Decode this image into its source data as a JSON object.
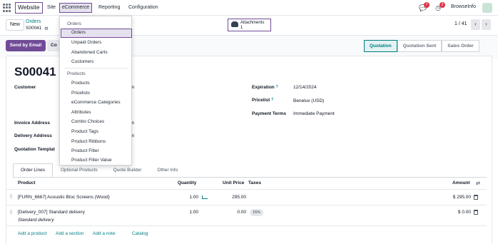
{
  "navbar": {
    "app_name": "Website",
    "menus": [
      "Site",
      "eCommerce",
      "Reporting",
      "Configuration"
    ],
    "chat_badge": "7",
    "activity_badge": "2",
    "company": "BrowseInfo"
  },
  "control_panel": {
    "new_label": "New",
    "breadcrumb_parent": "Orders",
    "breadcrumb_current": "S00041",
    "attachments_label": "Attachments",
    "attachments_count": "1",
    "pager": "1 / 41"
  },
  "actions": {
    "send_email": "Send by Email",
    "secondary_partial": "Co",
    "stages": [
      "Quotation",
      "Quotation Sent",
      "Sales Order"
    ],
    "current_stage": "Quotation"
  },
  "record": {
    "name": "S00041",
    "customer_label": "Customer",
    "customer_partial": "in",
    "invoice_address_label": "Invoice Address",
    "invoice_partial": "in",
    "delivery_address_label": "Delivery Address",
    "delivery_partial": "in",
    "template_label": "Quotation Templat",
    "expiration_label": "Expiration",
    "expiration_value": "12/14/2024",
    "pricelist_label": "Pricelist",
    "pricelist_value": "Benelux (USD)",
    "payment_terms_label": "Payment Terms",
    "payment_terms_value": "Immediate Payment",
    "help_mark": "?"
  },
  "tabs": [
    "Order Lines",
    "Optional Products",
    "Quote Builder",
    "Other Info"
  ],
  "order_lines": {
    "headers": {
      "product": "Product",
      "quantity": "Quantity",
      "unit_price": "Unit Price",
      "taxes": "Taxes",
      "amount": "Amount"
    },
    "rows": [
      {
        "product": "[FURN_6667] Acoustic Bloc Screens (Wood)",
        "quantity": "1.00",
        "unit_price": "295.00",
        "tax": "",
        "amount": "$ 295.00"
      },
      {
        "product": "[Delivery_007] Standard delivery",
        "description": "Standard delivery",
        "quantity": "1.00",
        "unit_price": "0.00",
        "tax": "15%",
        "amount": "$ 0.00"
      }
    ],
    "add_links": [
      "Add a product",
      "Add a section",
      "Add a note",
      "Catalog"
    ]
  },
  "dropdown": {
    "orders_header": "Orders",
    "orders_items": [
      "Orders",
      "Unpaid Orders",
      "Abandoned Carts",
      "Customers"
    ],
    "highlighted": "Orders",
    "products_header": "Products",
    "products_items": [
      "Products",
      "Pricelists",
      "eCommerce Categories",
      "Attributes",
      "Combo Choices",
      "Product Tags",
      "Product Ribbons",
      "Product Filter",
      "Product Filter Value"
    ]
  },
  "colors": {
    "brand": "#714b97",
    "link": "#017e84",
    "badge": "#dc3545"
  }
}
